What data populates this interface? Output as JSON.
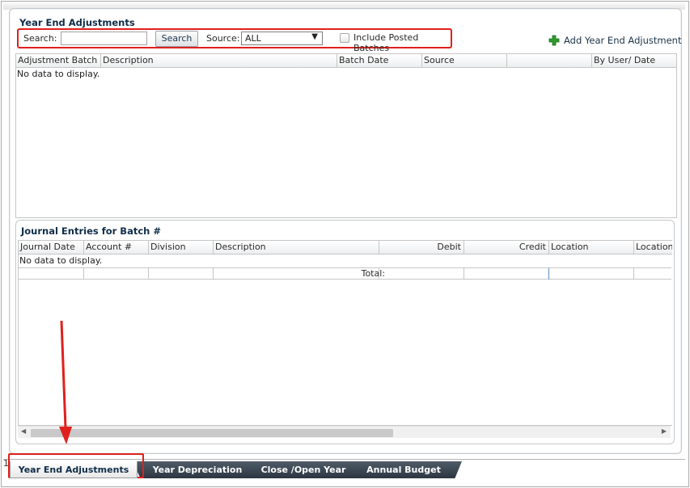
{
  "upper": {
    "title": "Year End Adjustments",
    "search_label": "Search:",
    "search_value": "",
    "search_button": "Search",
    "source_label": "Source:",
    "source_value": "ALL",
    "include_posted_label": "Include Posted Batches",
    "include_posted_checked": false,
    "add_button": "Add Year End Adjustment",
    "columns": [
      "Adjustment Batch #",
      "Description",
      "Batch Date",
      "Source",
      "",
      "By User/ Date"
    ],
    "empty_text": "No data to display."
  },
  "lower": {
    "title": "Journal Entries for Batch #",
    "columns": [
      "Journal Date",
      "Account #",
      "Division",
      "Description",
      "Debit",
      "Credit",
      "Location",
      "Location"
    ],
    "empty_text": "No data to display.",
    "total_label": "Total:"
  },
  "tabs": [
    {
      "label": "Year End Adjustments",
      "active": true
    },
    {
      "label": "Year Depreciation",
      "active": false
    },
    {
      "label": "Close /Open Year",
      "active": false
    },
    {
      "label": "Annual Budget",
      "active": false
    }
  ],
  "stray_char": "1",
  "colors": {
    "annotation_red": "#e0201c",
    "title_navy": "#0e2d48",
    "tab_dark": "#3a4652",
    "plus_green": "#2f9a2f"
  },
  "icons": {
    "add": "plus-icon",
    "dropdown": "chevron-down-icon",
    "scroll_left": "arrow-left-icon",
    "scroll_right": "arrow-right-icon"
  }
}
